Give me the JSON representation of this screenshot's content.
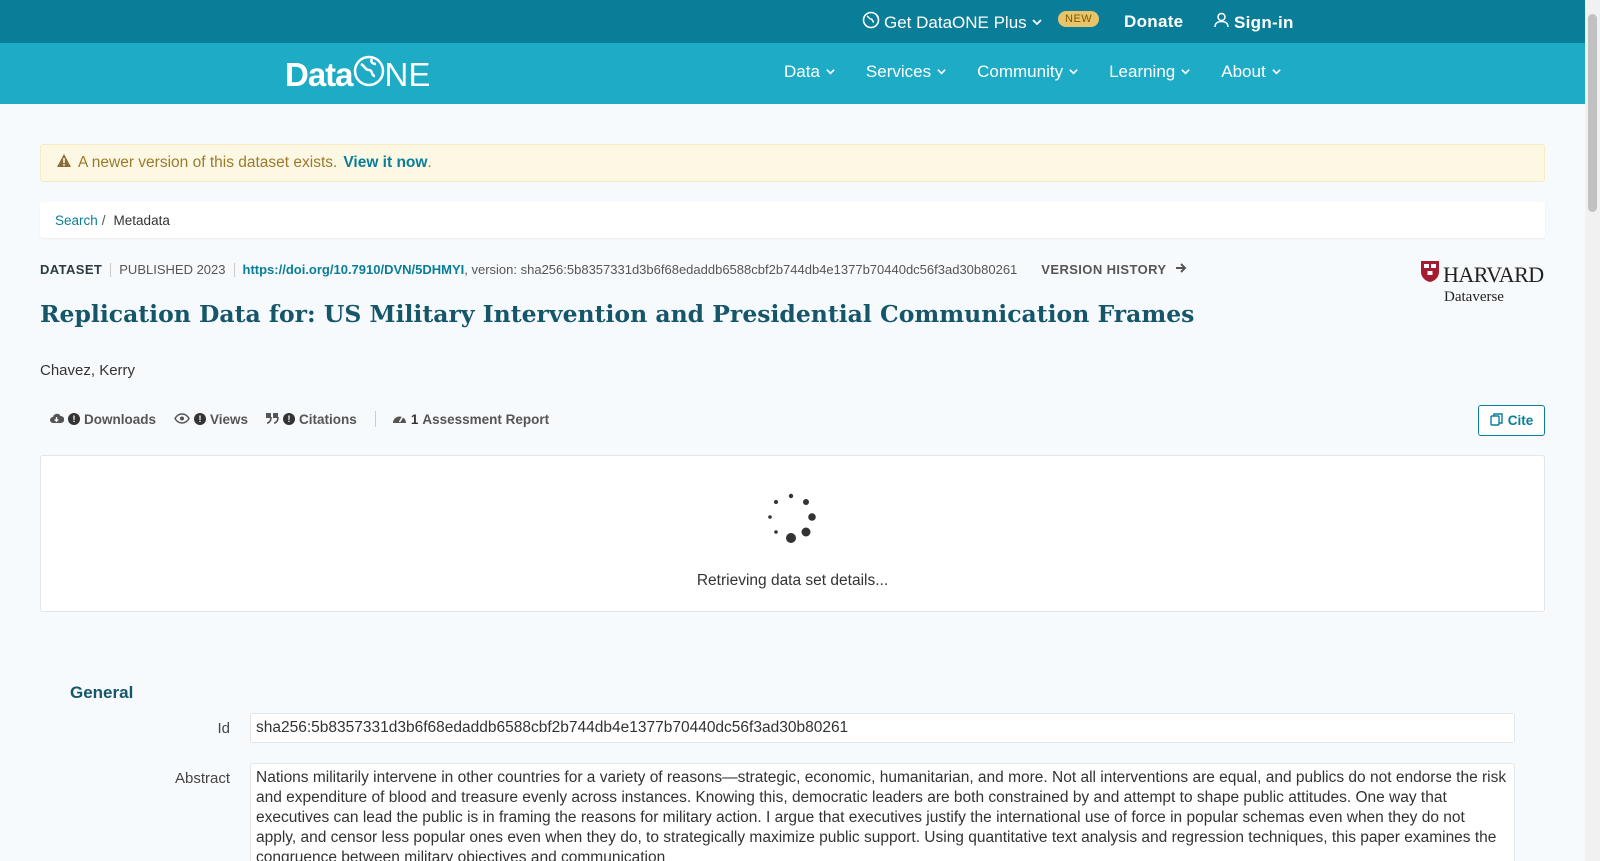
{
  "topbar": {
    "plus_label": "Get DataONE Plus",
    "new_badge": "NEW",
    "donate": "Donate",
    "signin": "Sign-in"
  },
  "navbar": {
    "logo_data": "Data",
    "logo_one": "NE",
    "items": [
      "Data",
      "Services",
      "Community",
      "Learning",
      "About"
    ]
  },
  "alert": {
    "text": "A newer version of this dataset exists.",
    "link": "View it now",
    "period": "."
  },
  "breadcrumb": {
    "search": "Search",
    "separator": "/",
    "current": "Metadata"
  },
  "dataset": {
    "type": "DATASET",
    "published": "PUBLISHED 2023",
    "doi": "https://doi.org/10.7910/DVN/5DHMYI",
    "version_text": ", version: sha256:5b8357331d3b6f68edaddb6588cbf2b744db4e1377b70440dc56f3ad30b80261",
    "version_history": "VERSION HISTORY",
    "title": "Replication Data for: US Military Intervention and Presidential Communication Frames",
    "author": "Chavez, Kerry"
  },
  "repository": {
    "name": "HARVARD",
    "sub": "Dataverse"
  },
  "metrics": {
    "downloads": "Downloads",
    "views": "Views",
    "citations": "Citations",
    "assessment_count": "1",
    "assessment": "Assessment Report",
    "cite": "Cite"
  },
  "loading": {
    "text": "Retrieving data set details..."
  },
  "general": {
    "title": "General",
    "id_label": "Id",
    "id_value": "sha256:5b8357331d3b6f68edaddb6588cbf2b744db4e1377b70440dc56f3ad30b80261",
    "abstract_label": "Abstract",
    "abstract_value": "Nations militarily intervene in other countries for a variety of reasons—strategic, economic, humanitarian, and more. Not all interventions are equal, and publics do not endorse the risk and expenditure of blood and treasure evenly across instances. Knowing this, democratic leaders are both constrained by and attempt to shape public attitudes. One way that executives can lead the public is in framing the reasons for military action. I argue that executives justify the international use of force in popular schemas even when they do not apply, and censor less popular ones even when they do, to strategically maximize public support. Using quantitative text analysis and regression techniques, this paper examines the congruence between military objectives and communication"
  },
  "colors": {
    "topbar": "#0a7e98",
    "navbar": "#1eabc5",
    "accent": "#0a7e98",
    "title": "#15566b"
  }
}
